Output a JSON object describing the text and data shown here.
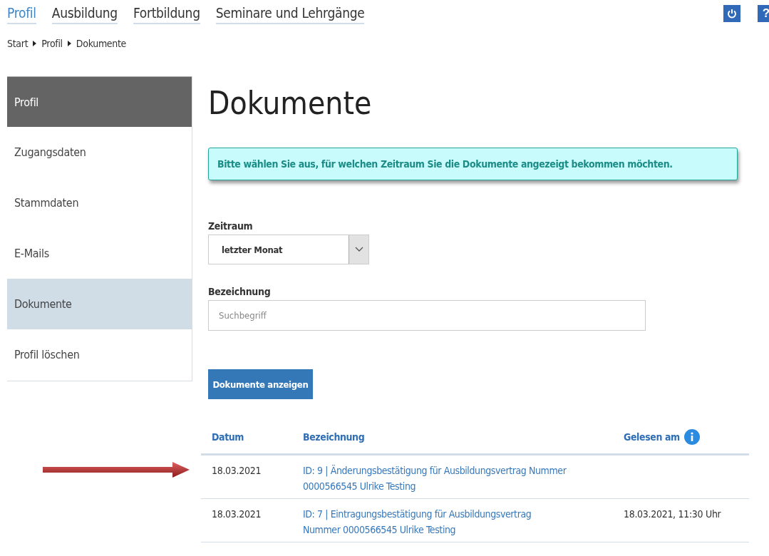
{
  "top_nav": [
    {
      "label": "Profil",
      "selected": true
    },
    {
      "label": "Ausbildung",
      "selected": false
    },
    {
      "label": "Fortbildung",
      "selected": false
    },
    {
      "label": "Seminare und Lehrgänge",
      "selected": false
    }
  ],
  "top_buttons": [
    {
      "kind": "power"
    },
    {
      "kind": "help",
      "label": "?"
    }
  ],
  "breadcrumb": [
    "Start",
    "Profil",
    "Dokumente"
  ],
  "sidebar": {
    "items": [
      {
        "label": "Profil",
        "kind": "header",
        "selected": false
      },
      {
        "label": "Zugangsdaten",
        "kind": "item",
        "selected": false
      },
      {
        "label": "Stammdaten",
        "kind": "item",
        "selected": false
      },
      {
        "label": "E-Mails",
        "kind": "item",
        "selected": false
      },
      {
        "label": "Dokumente",
        "kind": "item",
        "selected": true
      },
      {
        "label": "Profil löschen",
        "kind": "item",
        "selected": false
      }
    ]
  },
  "page_title": "Dokumente",
  "info_message": "Bitte wählen Sie aus, für welchen Zeitraum Sie die Dokumente angezeigt bekommen möchten.",
  "form": {
    "period": {
      "label": "Zeitraum",
      "value": "letzter Monat"
    },
    "name": {
      "label": "Bezeichnung",
      "placeholder": "Suchbegriff"
    },
    "submit": "Dokumente anzeigen"
  },
  "table": {
    "columns": [
      "Datum",
      "Bezeichnung",
      "Gelesen am"
    ],
    "rows": [
      {
        "date": "18.03.2021",
        "title": "ID: 9 | Änderungsbestätigung für Ausbildungsvertrag Nummer 0000566545 Ulrike Testing",
        "marker": {
          "kind": "arrow"
        }
      },
      {
        "date": "18.03.2021",
        "title": "ID: 7 | Eintragungsbestätigung für Ausbildungsvertrag Nummer 0000566545 Ulrike Testing",
        "read_at": "18.03.2021, 11:30 Uhr"
      }
    ]
  }
}
